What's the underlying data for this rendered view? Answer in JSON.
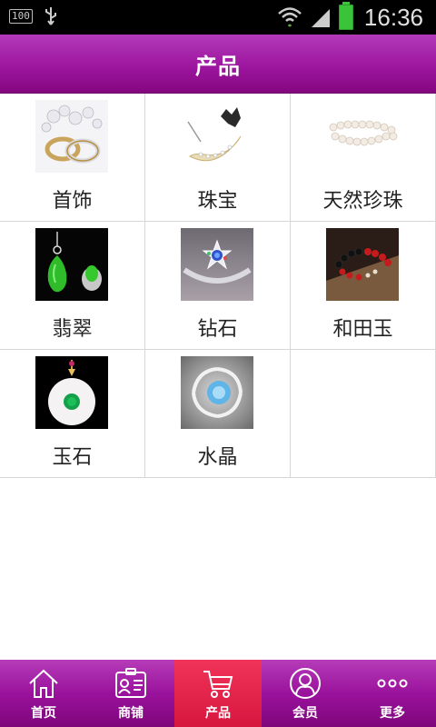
{
  "status_bar": {
    "battery_percent": "100",
    "time": "16:36"
  },
  "header": {
    "title": "产品"
  },
  "products": [
    {
      "label": "首饰",
      "icon": "rings-thumbnail"
    },
    {
      "label": "珠宝",
      "icon": "moon-brooch-thumbnail"
    },
    {
      "label": "天然珍珠",
      "icon": "pearl-necklace-thumbnail"
    },
    {
      "label": "翡翠",
      "icon": "jade-pendant-thumbnail"
    },
    {
      "label": "钻石",
      "icon": "diamond-ring-thumbnail"
    },
    {
      "label": "和田玉",
      "icon": "bead-bracelet-thumbnail"
    },
    {
      "label": "玉石",
      "icon": "jade-disc-pendant-thumbnail"
    },
    {
      "label": "水晶",
      "icon": "crystal-ring-thumbnail"
    }
  ],
  "bottom_nav": {
    "items": [
      {
        "label": "首页",
        "icon": "home-icon",
        "active": false
      },
      {
        "label": "商铺",
        "icon": "store-card-icon",
        "active": false
      },
      {
        "label": "产品",
        "icon": "cart-icon",
        "active": true
      },
      {
        "label": "会员",
        "icon": "member-icon",
        "active": false
      },
      {
        "label": "更多",
        "icon": "more-icon",
        "active": false
      }
    ]
  },
  "colors": {
    "header": "#9d169f",
    "active_tab": "#e0234a",
    "divider": "#d6d6d6"
  }
}
